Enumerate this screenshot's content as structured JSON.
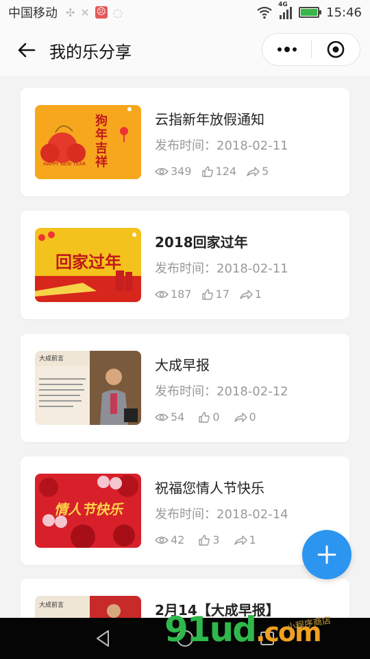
{
  "status_bar": {
    "carrier": "中国移动",
    "network": "4G",
    "time": "15:46"
  },
  "nav": {
    "title": "我的乐分享"
  },
  "posts": [
    {
      "title": "云指新年放假通知",
      "date": "发布时间：2018-02-11",
      "views": "349",
      "likes": "124",
      "shares": "5",
      "thumb_text": "狗年吉祥",
      "thumb_sub": "HAPPY NEW YEAR"
    },
    {
      "title": "2018回家过年",
      "date": "发布时间：2018-02-11",
      "views": "187",
      "likes": "17",
      "shares": "1",
      "thumb_text": "回家过年"
    },
    {
      "title": "大成早报",
      "date": "发布时间：2018-02-12",
      "views": "54",
      "likes": "0",
      "shares": "0",
      "thumb_text": "大成前言"
    },
    {
      "title": "祝福您情人节快乐",
      "date": "发布时间：2018-02-14",
      "views": "42",
      "likes": "3",
      "shares": "1",
      "thumb_text": "情人节快乐"
    },
    {
      "title": "2月14【大成早报】",
      "thumb_text": "大成前言"
    }
  ],
  "fab": {
    "label": "+"
  },
  "watermark": {
    "brand": "91ud",
    "tld": ".com",
    "small": "小程序商店"
  },
  "colors": {
    "accent": "#2b95f0",
    "background": "#f3f3f3"
  }
}
